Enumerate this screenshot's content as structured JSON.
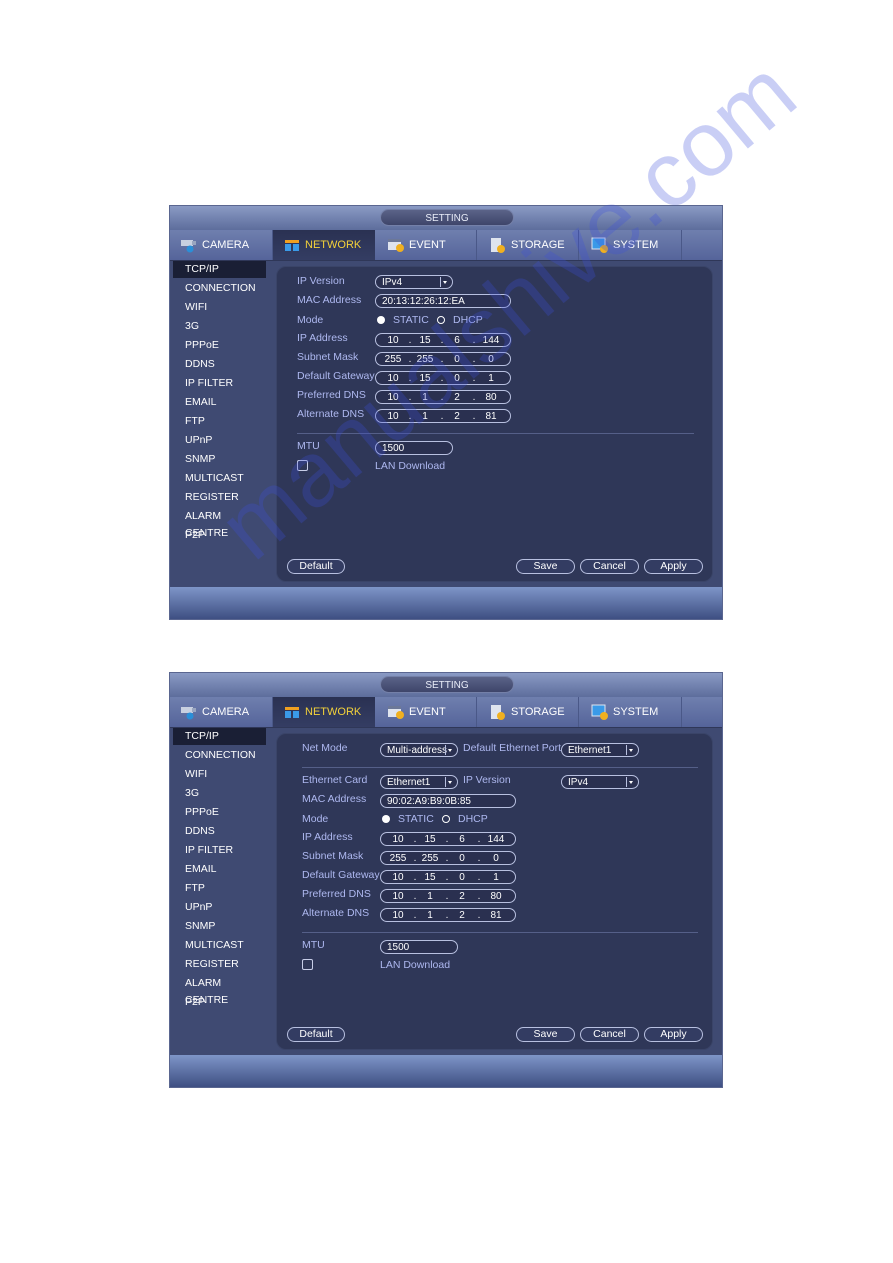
{
  "watermark": "manualshive.com",
  "windows": [
    {
      "title": "SETTING",
      "tabs": [
        {
          "label": "CAMERA",
          "icon": "camera-icon",
          "active": false
        },
        {
          "label": "NETWORK",
          "icon": "network-icon",
          "active": true
        },
        {
          "label": "EVENT",
          "icon": "event-icon",
          "active": false
        },
        {
          "label": "STORAGE",
          "icon": "storage-icon",
          "active": false
        },
        {
          "label": "SYSTEM",
          "icon": "system-icon",
          "active": false
        }
      ],
      "sidebar": [
        "TCP/IP",
        "CONNECTION",
        "WIFI",
        "3G",
        "PPPoE",
        "DDNS",
        "IP FILTER",
        "EMAIL",
        "FTP",
        "UPnP",
        "SNMP",
        "MULTICAST",
        "REGISTER",
        "ALARM CENTRE",
        "P2P"
      ],
      "sidebar_active": "TCP/IP",
      "form": {
        "ip_version_label": "IP Version",
        "ip_version_value": "IPv4",
        "mac_label": "MAC Address",
        "mac_value": "20:13:12:26:12:EA",
        "mode_label": "Mode",
        "mode_static": "STATIC",
        "mode_dhcp": "DHCP",
        "mode_selected": "STATIC",
        "ip_label": "IP Address",
        "ip": [
          "10",
          "15",
          "6",
          "144"
        ],
        "subnet_label": "Subnet Mask",
        "subnet": [
          "255",
          "255",
          "0",
          "0"
        ],
        "gateway_label": "Default Gateway",
        "gateway": [
          "10",
          "15",
          "0",
          "1"
        ],
        "pdns_label": "Preferred DNS",
        "pdns": [
          "10",
          "1",
          "2",
          "80"
        ],
        "adns_label": "Alternate DNS",
        "adns": [
          "10",
          "1",
          "2",
          "81"
        ],
        "mtu_label": "MTU",
        "mtu_value": "1500",
        "lan_download_label": "LAN Download",
        "lan_download_checked": false
      },
      "buttons": {
        "default": "Default",
        "save": "Save",
        "cancel": "Cancel",
        "apply": "Apply"
      }
    },
    {
      "title": "SETTING",
      "tabs": [
        {
          "label": "CAMERA",
          "icon": "camera-icon",
          "active": false
        },
        {
          "label": "NETWORK",
          "icon": "network-icon",
          "active": true
        },
        {
          "label": "EVENT",
          "icon": "event-icon",
          "active": false
        },
        {
          "label": "STORAGE",
          "icon": "storage-icon",
          "active": false
        },
        {
          "label": "SYSTEM",
          "icon": "system-icon",
          "active": false
        }
      ],
      "sidebar": [
        "TCP/IP",
        "CONNECTION",
        "WIFI",
        "3G",
        "PPPoE",
        "DDNS",
        "IP FILTER",
        "EMAIL",
        "FTP",
        "UPnP",
        "SNMP",
        "MULTICAST",
        "REGISTER",
        "ALARM CENTRE",
        "P2P"
      ],
      "sidebar_active": "TCP/IP",
      "form": {
        "net_mode_label": "Net Mode",
        "net_mode_value": "Multi-address",
        "default_port_label": "Default Ethernet Port",
        "default_port_value": "Ethernet1",
        "eth_card_label": "Ethernet Card",
        "eth_card_value": "Ethernet1",
        "ip_version_label": "IP Version",
        "ip_version_value": "IPv4",
        "mac_label": "MAC Address",
        "mac_value": "90:02:A9:B9:0B:85",
        "mode_label": "Mode",
        "mode_static": "STATIC",
        "mode_dhcp": "DHCP",
        "mode_selected": "STATIC",
        "ip_label": "IP Address",
        "ip": [
          "10",
          "15",
          "6",
          "144"
        ],
        "subnet_label": "Subnet Mask",
        "subnet": [
          "255",
          "255",
          "0",
          "0"
        ],
        "gateway_label": "Default Gateway",
        "gateway": [
          "10",
          "15",
          "0",
          "1"
        ],
        "pdns_label": "Preferred DNS",
        "pdns": [
          "10",
          "1",
          "2",
          "80"
        ],
        "adns_label": "Alternate DNS",
        "adns": [
          "10",
          "1",
          "2",
          "81"
        ],
        "mtu_label": "MTU",
        "mtu_value": "1500",
        "lan_download_label": "LAN Download",
        "lan_download_checked": false
      },
      "buttons": {
        "default": "Default",
        "save": "Save",
        "cancel": "Cancel",
        "apply": "Apply"
      }
    }
  ]
}
